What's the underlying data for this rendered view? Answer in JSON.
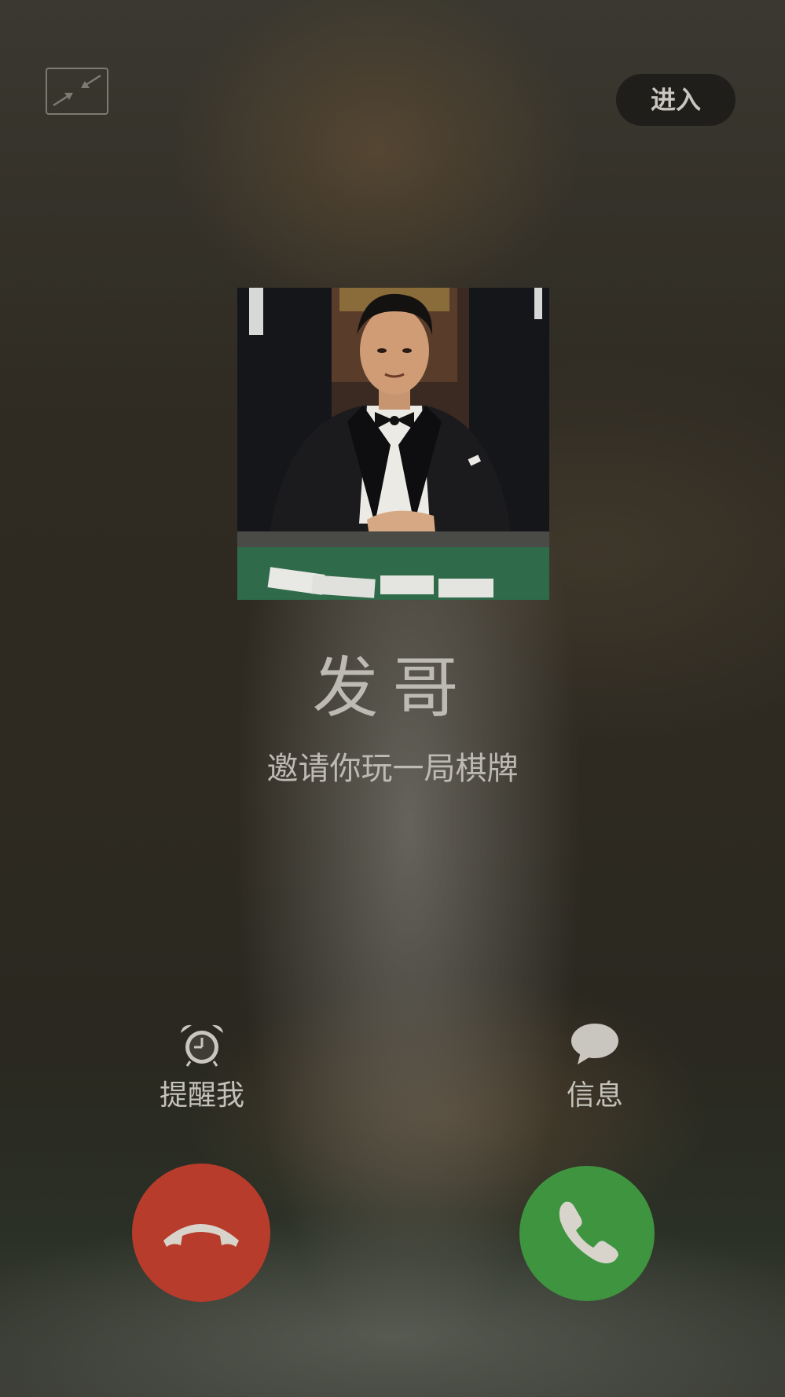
{
  "header": {
    "enter_label": "进入"
  },
  "caller": {
    "name": "发哥",
    "invite_text": "邀请你玩一局棋牌"
  },
  "actions": {
    "remind_label": "提醒我",
    "message_label": "信息"
  },
  "icons": {
    "minimize": "minimize-icon",
    "alarm": "alarm-clock-icon",
    "message": "chat-bubble-icon",
    "decline": "phone-hangup-icon",
    "accept": "phone-icon"
  },
  "colors": {
    "decline": "#b83c2c",
    "accept": "#3f9440",
    "enter_bg": "#1f1e1a"
  }
}
